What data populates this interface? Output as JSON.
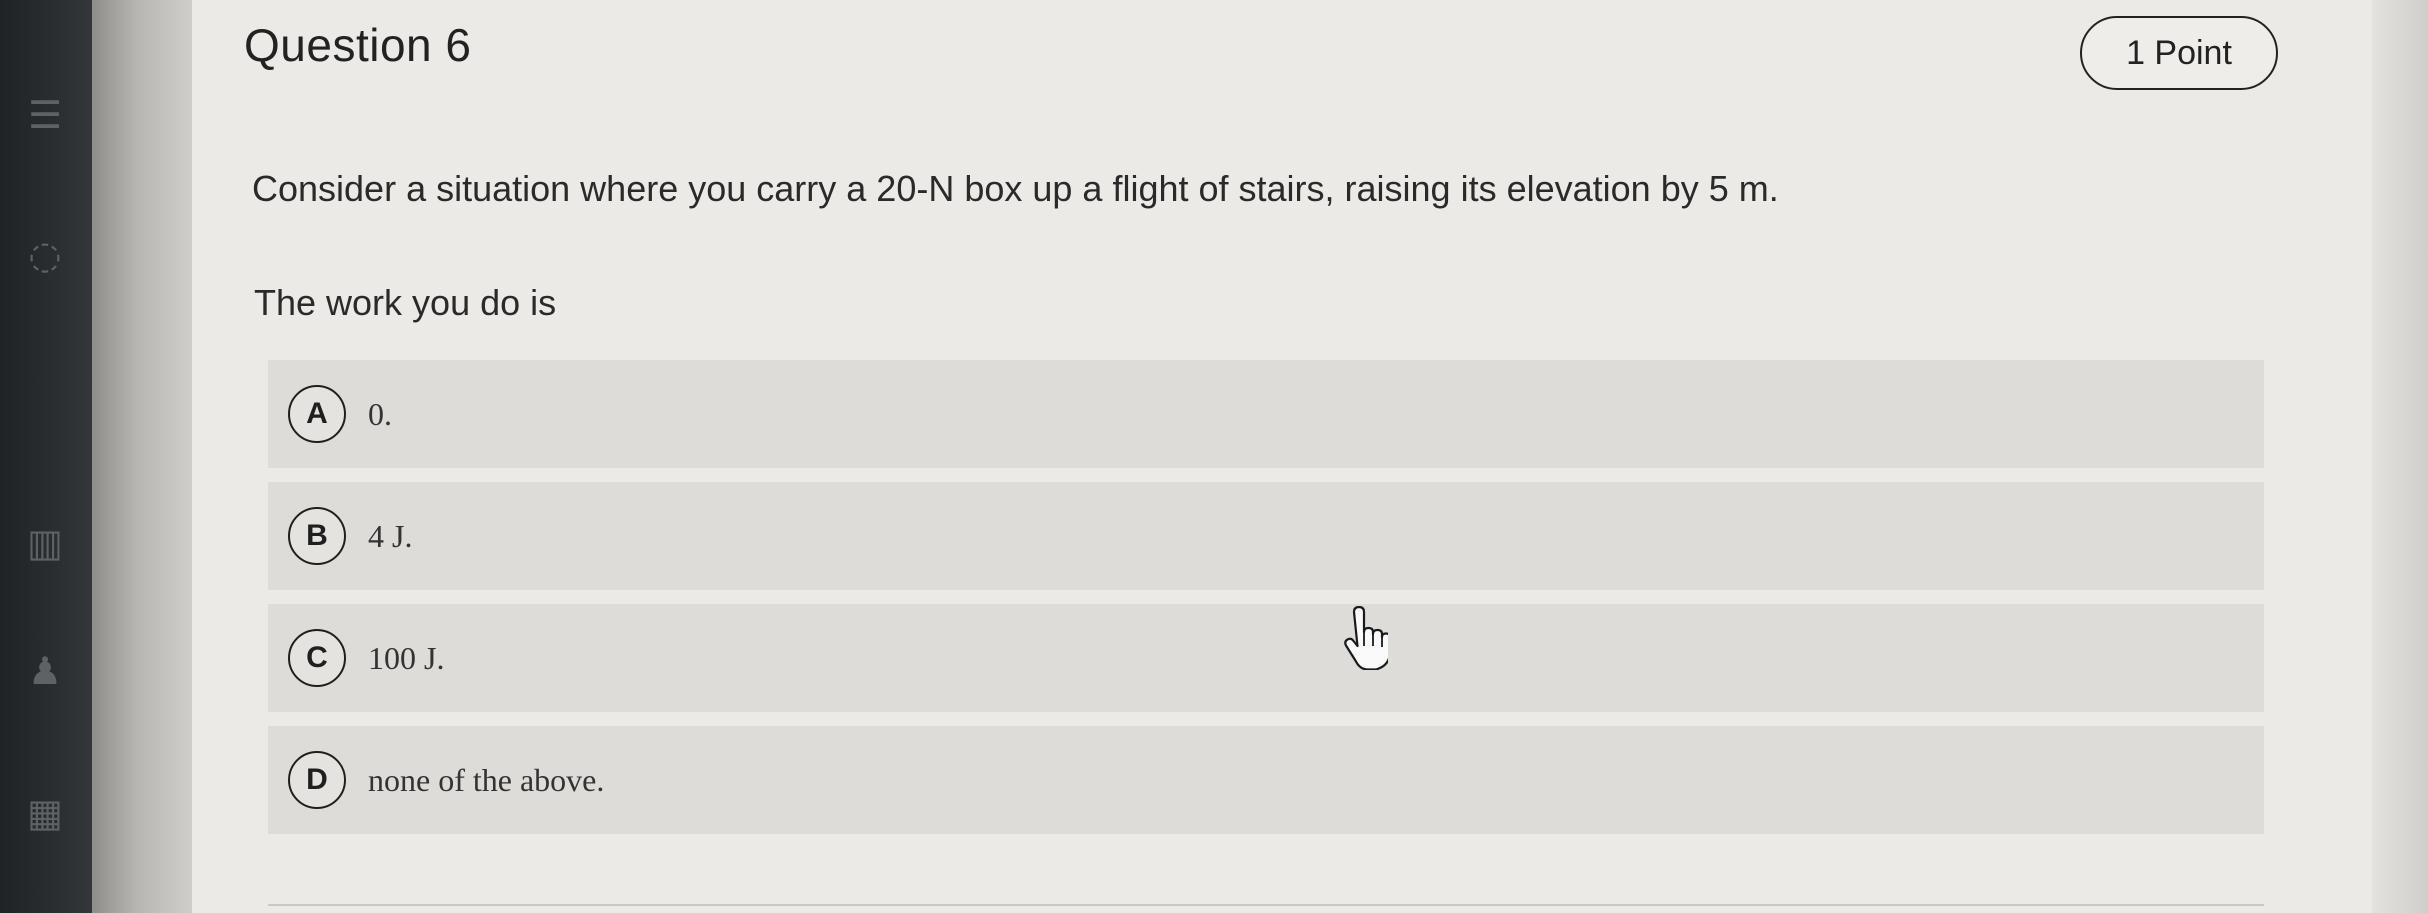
{
  "question": {
    "title": "Question 6",
    "points": "1 Point",
    "text": "Consider a situation where you carry a 20-N box up a flight of stairs, raising its elevation by 5 m.",
    "prompt": "The work you do is"
  },
  "options": [
    {
      "letter": "A",
      "text": "0."
    },
    {
      "letter": "B",
      "text": "4 J."
    },
    {
      "letter": "C",
      "text": "100 J."
    },
    {
      "letter": "D",
      "text": "none of the above."
    }
  ],
  "icons": [
    "book-icon",
    "people-icon",
    "calendar-icon",
    "hand-pointer-icon"
  ]
}
